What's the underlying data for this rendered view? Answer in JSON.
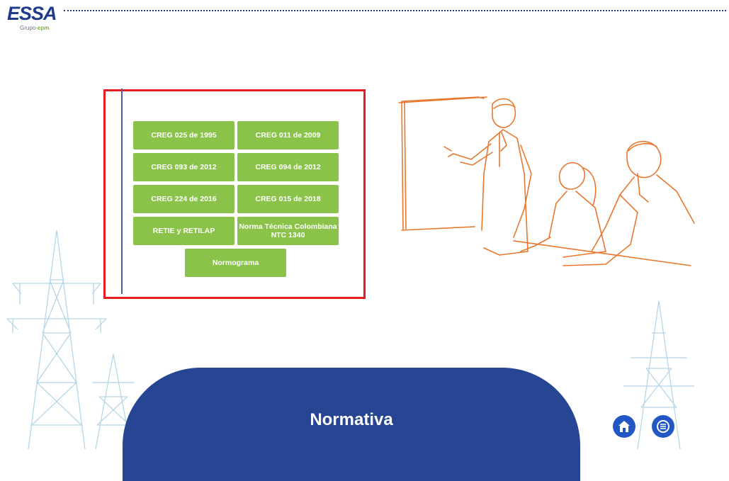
{
  "header": {
    "logo_text": "ESSA",
    "logo_sub_prefix": "Grupo-",
    "logo_sub_brand": "epm"
  },
  "buttons": [
    "CREG 025 de 1995",
    "CREG 011 de 2009",
    "CREG 093 de 2012",
    "CREG 094 de 2012",
    "CREG 224 de 2016",
    "CREG 015 de 2018",
    "RETIE y RETILAP",
    "Norma Técnica Colombiana NTC 1340",
    "Normograma"
  ],
  "banner": {
    "title": "Normativa"
  },
  "icons": {
    "home": "home-icon",
    "menu": "list-menu-icon"
  },
  "colors": {
    "brand_blue": "#264592",
    "button_green": "#8bc34a",
    "highlight_red": "#e51c24",
    "illustration_orange": "#e8772e"
  }
}
